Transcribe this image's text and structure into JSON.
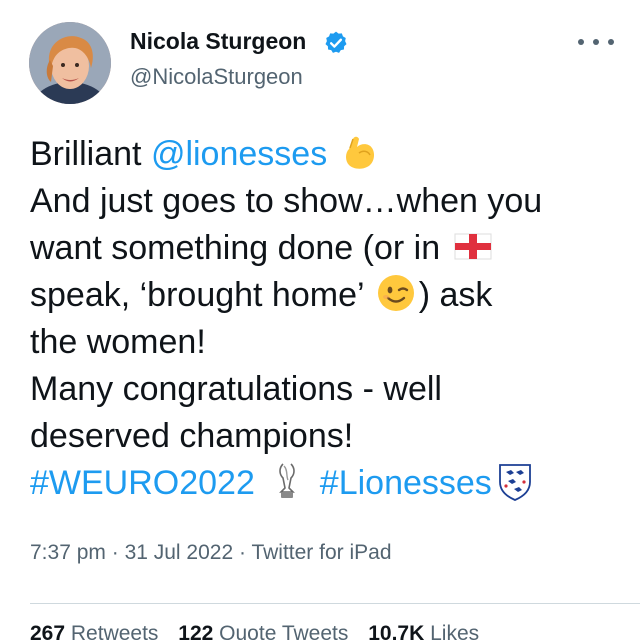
{
  "tweet": {
    "author": {
      "name": "Nicola Sturgeon",
      "handle": "@NicolaSturgeon",
      "verified": true
    },
    "body": {
      "line1_text": "Brilliant ",
      "line1_mention": "@lionesses",
      "line1_emoji": "flexed-biceps-emoji",
      "line2": "And just goes to show…when you",
      "line3_text": "want something done (or in ",
      "line3_emoji": "england-flag-emoji",
      "line4_text_a": "speak, ‘brought home’ ",
      "line4_emoji": "winking-face-emoji",
      "line4_text_b": ") ask",
      "line5": "the women!",
      "line6": "Many congratulations - well",
      "line7": "deserved champions!",
      "hashtag1": "#WEURO2022",
      "hashtag1_emoji": "trophy-emoji",
      "hashtag2": "#Lionesses",
      "hashtag2_emoji": "england-crest-emoji"
    },
    "meta": {
      "time": "7:37 pm",
      "separator1": " · ",
      "date": "31 Jul 2022",
      "separator2": " · ",
      "source": "Twitter for iPad"
    },
    "stats": {
      "retweets_count": "267",
      "retweets_label": "Retweets",
      "quotes_count": "122",
      "quotes_label": "Quote Tweets",
      "likes_count": "10.7K",
      "likes_label": "Likes"
    }
  },
  "colors": {
    "link": "#1d9bf0",
    "text": "#0f1419",
    "secondary": "#536471",
    "divider": "#cfd9de"
  }
}
